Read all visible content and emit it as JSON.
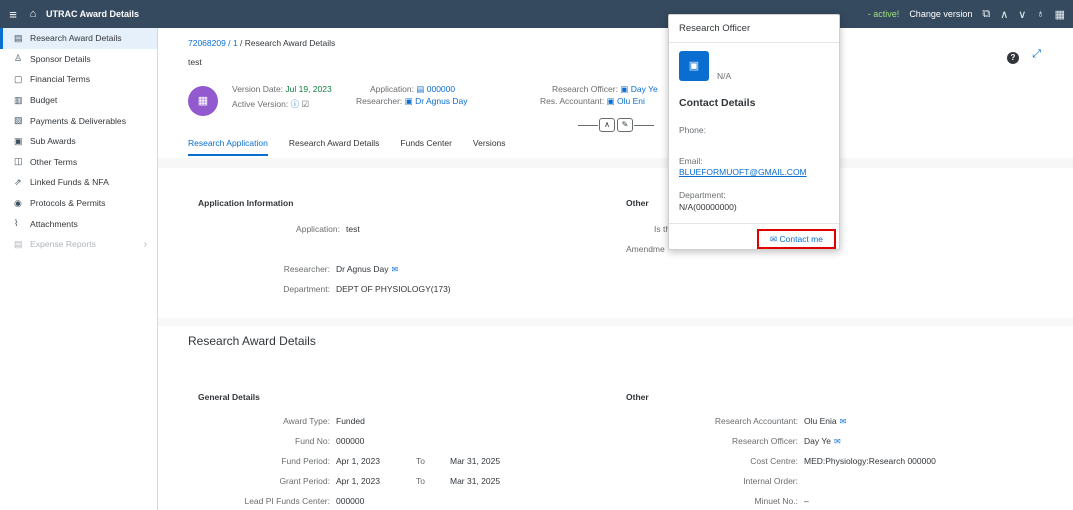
{
  "shell": {
    "menu_icon": "hamburger-icon",
    "home_icon": "home-icon",
    "title": "UTRAC Award Details",
    "status": "- active!",
    "change_version": "Change version"
  },
  "sidebar": {
    "items": [
      {
        "label": "Research Award Details",
        "icon": "document-icon",
        "active": true
      },
      {
        "label": "Sponsor Details",
        "icon": "person-icon"
      },
      {
        "label": "Financial Terms",
        "icon": "doc-icon"
      },
      {
        "label": "Budget",
        "icon": "budget-icon"
      },
      {
        "label": "Payments & Deliverables",
        "icon": "payment-icon"
      },
      {
        "label": "Sub Awards",
        "icon": "sub-award-icon"
      },
      {
        "label": "Other Terms",
        "icon": "terms-icon"
      },
      {
        "label": "Linked Funds & NFA",
        "icon": "link-icon"
      },
      {
        "label": "Protocols & Permits",
        "icon": "permit-icon"
      },
      {
        "label": "Attachments",
        "icon": "paperclip-icon"
      },
      {
        "label": "Expense Reports",
        "icon": "report-icon",
        "disabled": true
      }
    ]
  },
  "header": {
    "breadcrumb_link": "72068209 / 1",
    "breadcrumb_rest": " / Research Award Details",
    "subtitle": "test",
    "version_date_label": "Version Date:",
    "version_date": "Jul 19, 2023",
    "active_version_label": "Active Version:",
    "application_label": "Application:",
    "application_value": "000000",
    "researcher_label": "Researcher:",
    "researcher_value": "Dr Agnus Day",
    "research_officer_label": "Research Officer:",
    "research_officer_value": "Day Ye",
    "res_accountant_label": "Res. Accountant:",
    "res_accountant_value": "Olu Eni",
    "tabs": [
      "Research Application",
      "Research Award Details",
      "Funds Center",
      "Versions"
    ]
  },
  "app_info": {
    "title": "Application Information",
    "other_title": "Other",
    "application_label": "Application:",
    "application_value": "test",
    "researcher_label": "Researcher:",
    "researcher_value": "Dr Agnus Day",
    "department_label": "Department:",
    "department_value": "DEPT OF PHYSIOLOGY(173)",
    "is_this_label": "Is this",
    "amendment_label": "Amendme"
  },
  "award_details": {
    "title": "Research Award Details",
    "general_title": "General Details",
    "other_title": "Other",
    "award_type_label": "Award Type:",
    "award_type_value": "Funded",
    "fund_no_label": "Fund No:",
    "fund_no_value": "000000",
    "fund_period_label": "Fund Period:",
    "fund_period_from": "Apr 1, 2023",
    "to_label": "To",
    "fund_period_to": "Mar 31, 2025",
    "grant_period_label": "Grant Period:",
    "grant_period_from": "Apr 1, 2023",
    "grant_period_to": "Mar 31, 2025",
    "lead_pi_label": "Lead PI Funds Center:",
    "lead_pi_value": "000000",
    "research_accountant_label": "Research Accountant:",
    "research_accountant_value": "Olu Enia",
    "research_officer_label": "Research Officer:",
    "research_officer_value": "Day Ye",
    "cost_centre_label": "Cost Centre:",
    "cost_centre_value": "MED:Physiology:Research 000000",
    "internal_order_label": "Internal Order:",
    "minuet_no_label": "Minuet No.:",
    "minuet_no_value": "–"
  },
  "popover": {
    "title": "Research Officer",
    "name_value": "N/A",
    "contact_heading": "Contact Details",
    "phone_label": "Phone:",
    "email_label": "Email:",
    "email_value": "BLUEFORMUOFT@GMAIL.COM",
    "department_label": "Department:",
    "department_value": "N/A(00000000)",
    "contact_button": "Contact me"
  }
}
